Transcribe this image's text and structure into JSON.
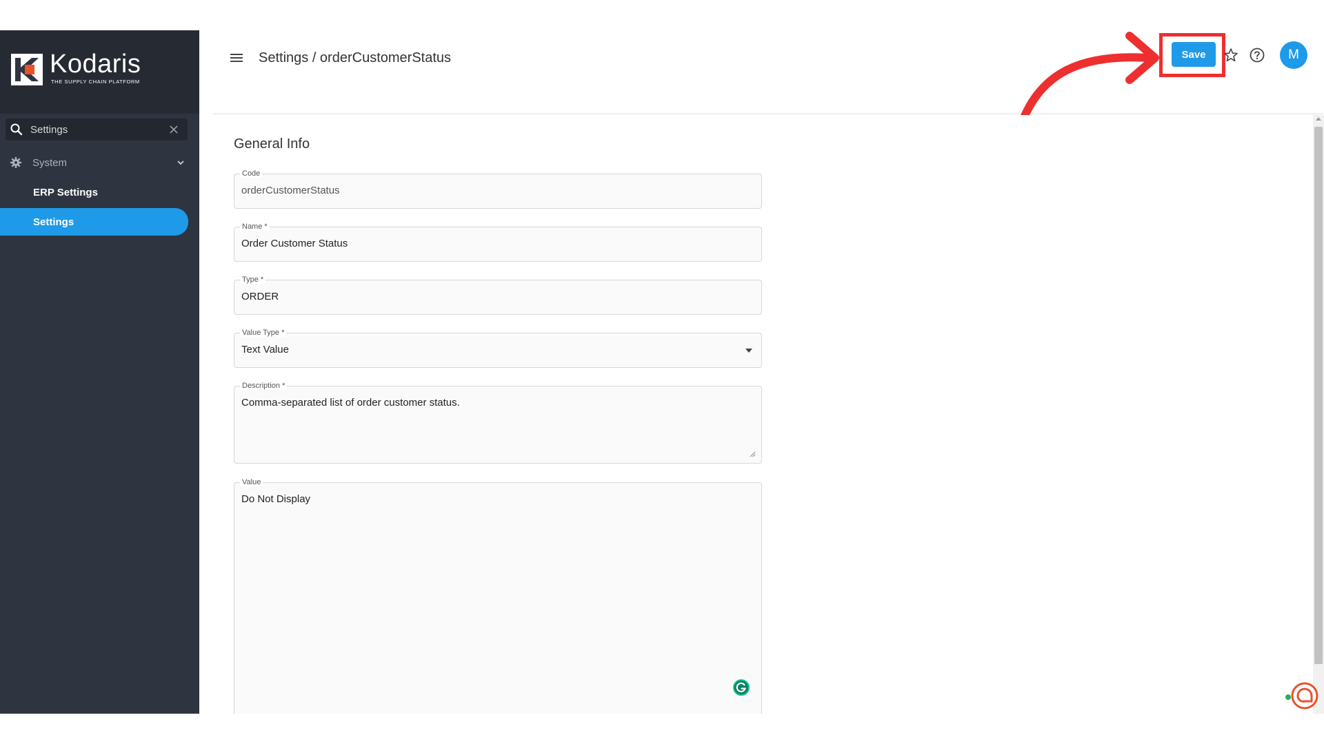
{
  "brand": {
    "name": "Kodaris",
    "tagline": "THE SUPPLY CHAIN PLATFORM",
    "accent": "#1e9ae8",
    "logo_orange": "#e8522a"
  },
  "sidebar": {
    "search": {
      "value": "Settings"
    },
    "group": {
      "label": "System",
      "icon": "gear-icon"
    },
    "items": [
      {
        "label": "ERP Settings",
        "active": false
      },
      {
        "label": "Settings",
        "active": true
      }
    ]
  },
  "header": {
    "breadcrumb": "Settings / orderCustomerStatus",
    "save_label": "Save",
    "avatar_initial": "M",
    "highlight_color": "#ee2f2f"
  },
  "form": {
    "section_title": "General Info",
    "fields": {
      "code": {
        "label": "Code",
        "value": "orderCustomerStatus"
      },
      "name": {
        "label": "Name *",
        "value": "Order Customer Status"
      },
      "type": {
        "label": "Type *",
        "value": "ORDER"
      },
      "value_type": {
        "label": "Value Type *",
        "value": "Text Value"
      },
      "description": {
        "label": "Description *",
        "value": "Comma-separated list of order customer status."
      },
      "value": {
        "label": "Value",
        "value": "Do Not Display"
      }
    }
  }
}
